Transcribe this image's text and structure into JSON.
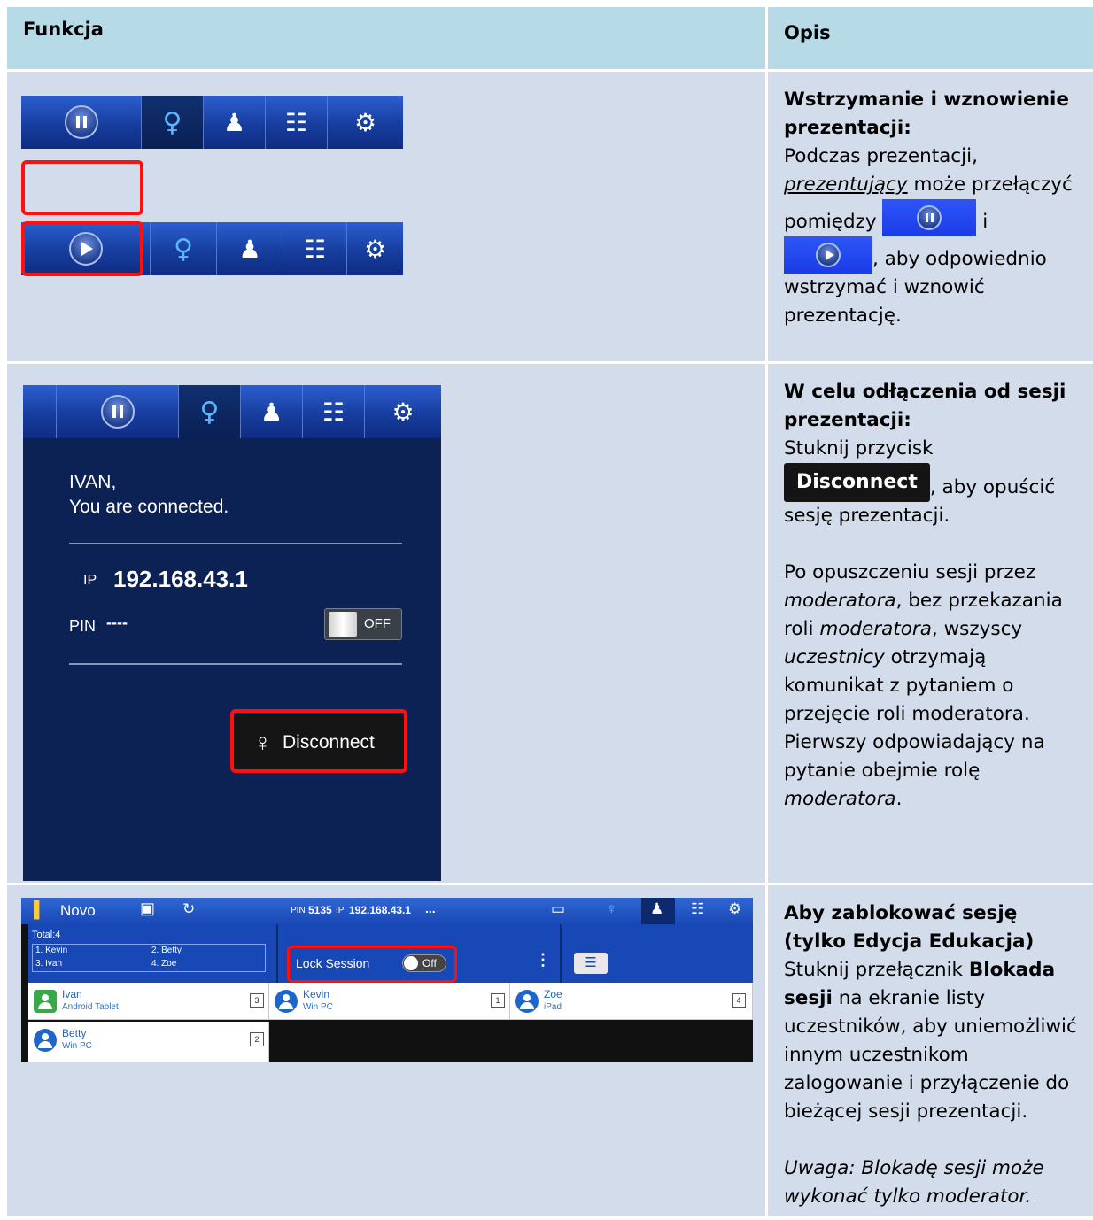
{
  "table": {
    "headers": {
      "feature": "Funkcja",
      "description": "Opis"
    }
  },
  "row1": {
    "title": "Wstrzymanie i wznowienie prezentacji:",
    "t1": "Podczas prezentacji, ",
    "t2_italic": "prezentujący",
    "t3": " może przełączyć pomiędzy ",
    "t4": " i ",
    "t5": ", aby odpowiednio wstrzymać i wznowić prezentację."
  },
  "row2": {
    "title": "W celu odłączenia od sesji prezentacji:",
    "t1": "Stuknij przycisk ",
    "disconnect_inline": "Disconnect",
    "t2": ", aby opuścić sesję prezentacji.",
    "p2_a": "Po opuszczeniu sesji przez ",
    "p2_b": "moderatora",
    "p2_c": ", bez przekazania roli ",
    "p2_d": "moderatora",
    "p2_e": ", wszyscy ",
    "p2_f": "uczestnicy",
    "p2_g": " otrzymają komunikat z pytaniem o przejęcie roli moderatora. Pierwszy odpowiadający na pytanie obejmie rolę ",
    "p2_h": "moderatora",
    "p2_i": "."
  },
  "row3": {
    "title": "Aby zablokować sesję (tylko Edycja Edukacja)",
    "t1": "Stuknij przełącznik ",
    "t2_bold": "Blokada sesji",
    "t3": " na ekranie listy uczestników, aby uniemożliwić innym uczestnikom zalogowanie i przyłączenie do bieżącej sesji prezentacji.",
    "note": "Uwaga: Blokadę sesji może wykonać tylko moderator."
  },
  "panel": {
    "name": "IVAN,",
    "status": "You are connected.",
    "ip_label": "IP",
    "ip": "192.168.43.1",
    "pin_label": "PIN",
    "pin": "----",
    "toggle": "OFF",
    "disconnect": "Disconnect"
  },
  "novo": {
    "app": "Novo",
    "pin_label": "PIN",
    "pin": "5135",
    "ip_label": "IP",
    "ip": "192.168.43.1",
    "more": "...",
    "total": "Total:4",
    "list": [
      "1. Kevin",
      "2. Betty",
      "3. Ivan",
      "4. Zoe"
    ],
    "lock_label": "Lock Session",
    "lock_state": "Off",
    "participants": [
      {
        "name": "Ivan",
        "device": "Android Tablet",
        "slot": "3"
      },
      {
        "name": "Kevin",
        "device": "Win PC",
        "slot": "1"
      },
      {
        "name": "Zoe",
        "device": "iPad",
        "slot": "4"
      },
      {
        "name": "Betty",
        "device": "Win PC",
        "slot": "2"
      }
    ]
  },
  "icons": [
    "pause-icon",
    "play-icon",
    "link-icon",
    "users-icon",
    "grid-icon",
    "gear-icon"
  ],
  "colors": {
    "header_bg": "#b7dbe6",
    "row_bg": "#d3dcea",
    "highlight": "#ff1010",
    "toolbar_blue": "#1a49b5"
  }
}
